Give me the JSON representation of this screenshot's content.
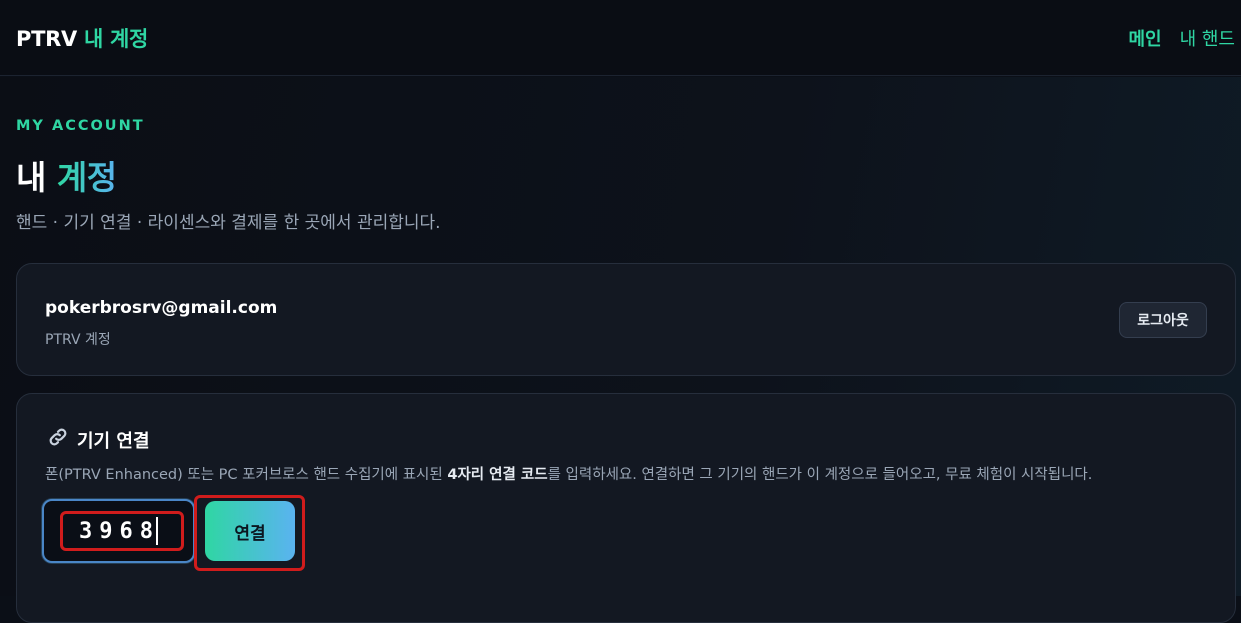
{
  "header": {
    "brand_prefix": "PTRV",
    "brand_suffix": "내 계정",
    "nav": [
      {
        "label": "메인"
      },
      {
        "label": "내 핸드"
      }
    ]
  },
  "page": {
    "eyebrow": "MY ACCOUNT",
    "title_part1": "내",
    "title_part2": "계정",
    "subtitle": "핸드 · 기기 연결 · 라이센스와 결제를 한 곳에서 관리합니다."
  },
  "account": {
    "email": "pokerbrosrv@gmail.com",
    "label": "PTRV 계정",
    "logout_label": "로그아웃"
  },
  "device": {
    "icon": "link-icon",
    "title": "기기 연결",
    "desc_before": "폰(PTRV Enhanced) 또는 PC 포커브로스 핸드 수집기에 표시된 ",
    "desc_bold": "4자리 연결 코드",
    "desc_after": "를 입력하세요. 연결하면 그 기기의 핸드가 이 계정으로 들어오고, 무료 체험이 시작됩니다.",
    "code_value": "3968",
    "connect_label": "연결"
  },
  "colors": {
    "accent_green": "#2fd6a3",
    "accent_blue": "#5ab3f0",
    "highlight_red": "#d01c1c"
  }
}
